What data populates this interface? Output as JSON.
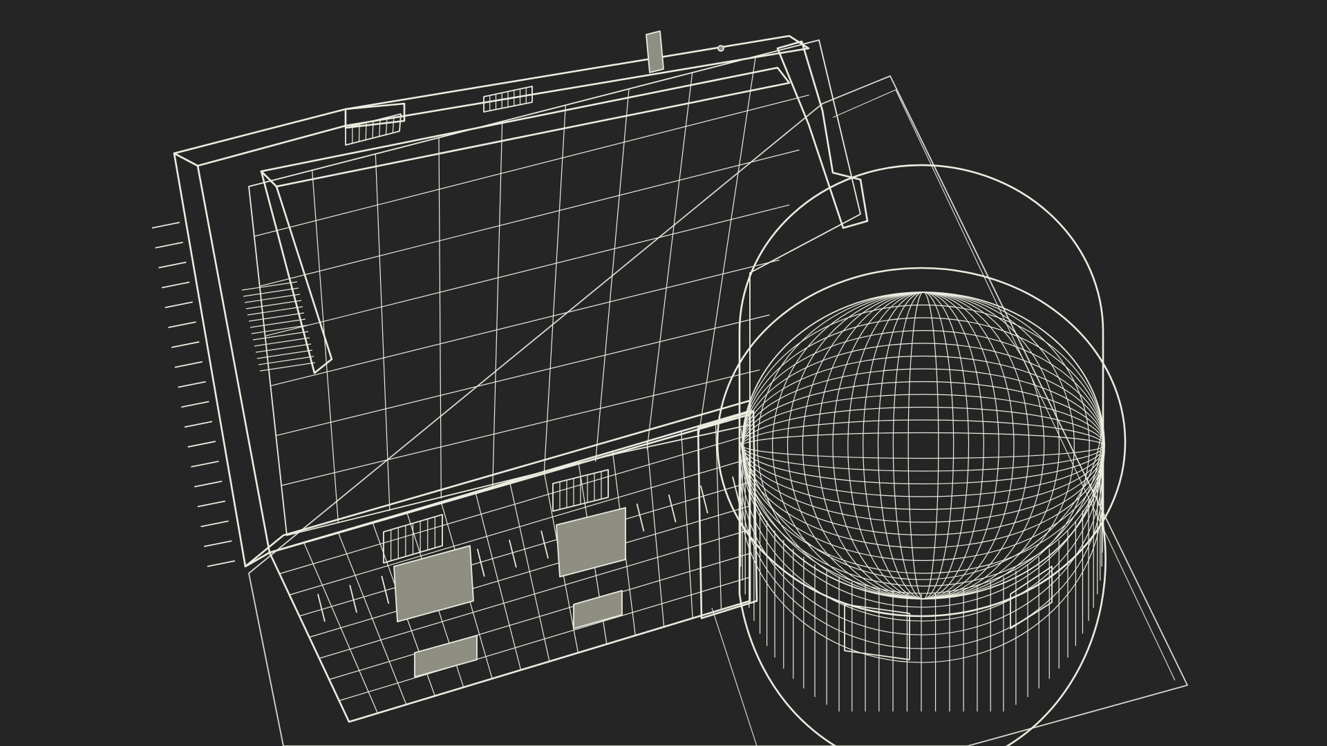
{
  "colors": {
    "background": "#252525",
    "ground": "#65655c",
    "ground_edge": "#d9d9d0",
    "floor": "#606058",
    "wall_top": "#8e8e83",
    "wall_face": "#76766c",
    "dome": "#6b6b61",
    "wire": "#ecece0",
    "lattice": "#bdbdb2"
  },
  "scene": {
    "subject": "building-wireframe-render"
  }
}
